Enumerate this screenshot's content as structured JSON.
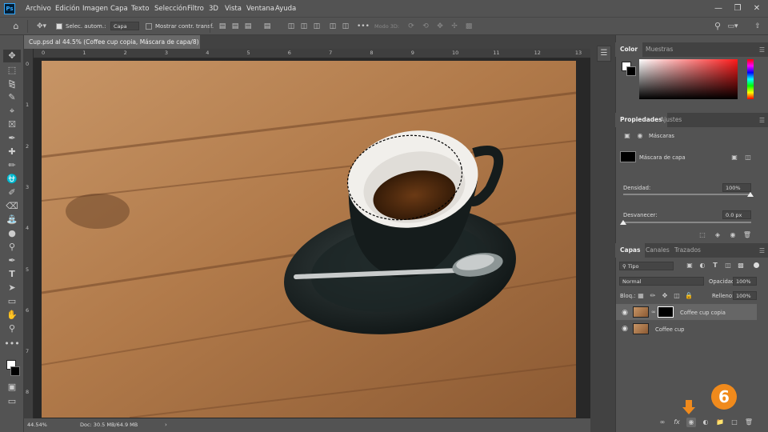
{
  "app": {
    "logo": "Ps"
  },
  "menu": [
    "Archivo",
    "Edición",
    "Imagen",
    "Capa",
    "Texto",
    "Selección",
    "Filtro",
    "3D",
    "Vista",
    "Ventana",
    "Ayuda"
  ],
  "options": {
    "auto_select_label": "Selec. autom.:",
    "auto_select_value": "Capa",
    "show_transform_label": "Mostrar contr. transf.",
    "mode3d_label": "Modo 3D:"
  },
  "document": {
    "tab_title": "Cup.psd al 44.5% (Coffee cup copia, Máscara de capa/8) *",
    "zoom": "44.54%",
    "doc_info": "Doc: 30.5 MB/64.9 MB"
  },
  "ruler": {
    "h_ticks": [
      "0",
      "1",
      "2",
      "3",
      "4",
      "5",
      "6",
      "7",
      "8",
      "9",
      "10",
      "11",
      "12",
      "13"
    ],
    "v_ticks": [
      "0",
      "1",
      "2",
      "3",
      "4",
      "5",
      "6",
      "7",
      "8"
    ]
  },
  "color_panel": {
    "tabs": [
      "Color",
      "Muestras"
    ]
  },
  "properties_panel": {
    "tabs": [
      "Propiedades",
      "Ajustes"
    ],
    "masks_label": "Máscaras",
    "layer_mask_label": "Máscara de capa",
    "density_label": "Densidad:",
    "density_value": "100%",
    "feather_label": "Desvanecer:",
    "feather_value": "0.0 px"
  },
  "layers_panel": {
    "tabs": [
      "Capas",
      "Canales",
      "Trazados"
    ],
    "filter_kind": "Tipo",
    "blend_mode": "Normal",
    "opacity_label": "Opacidad:",
    "opacity_value": "100%",
    "lock_label": "Bloq.:",
    "fill_label": "Relleno:",
    "fill_value": "100%",
    "layers": [
      {
        "name": "Coffee cup copia",
        "has_mask": true,
        "selected": true
      },
      {
        "name": "Coffee cup",
        "has_mask": false,
        "selected": false
      }
    ],
    "footer_fx": "fx"
  },
  "callout": {
    "step_number": "6",
    "color": "#f08a1c"
  }
}
